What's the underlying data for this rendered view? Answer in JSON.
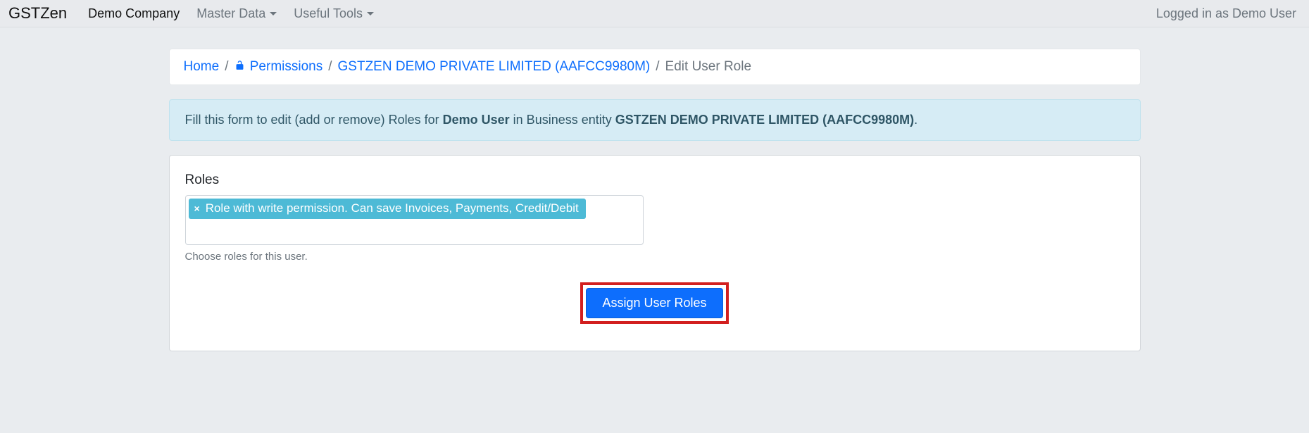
{
  "navbar": {
    "brand": "GSTZen",
    "items": [
      {
        "label": "Demo Company",
        "active": true,
        "dropdown": false
      },
      {
        "label": "Master Data",
        "active": false,
        "dropdown": true
      },
      {
        "label": "Useful Tools",
        "active": false,
        "dropdown": true
      }
    ],
    "right_label": "Logged in as Demo User"
  },
  "breadcrumb": {
    "home": "Home",
    "permissions": "Permissions",
    "entity": "GSTZEN DEMO PRIVATE LIMITED (AAFCC9980M)",
    "current": "Edit User Role",
    "sep": "/"
  },
  "alert": {
    "prefix": "Fill this form to edit (add or remove) Roles for ",
    "user": "Demo User",
    "mid": " in Business entity ",
    "entity": "GSTZEN DEMO PRIVATE LIMITED (AAFCC9980M)",
    "suffix": "."
  },
  "form": {
    "roles_label": "Roles",
    "selected_role": "Role with write permission. Can save Invoices, Payments, Credit/Debit",
    "remove_glyph": "×",
    "help_text": "Choose roles for this user.",
    "submit_label": "Assign User Roles"
  }
}
